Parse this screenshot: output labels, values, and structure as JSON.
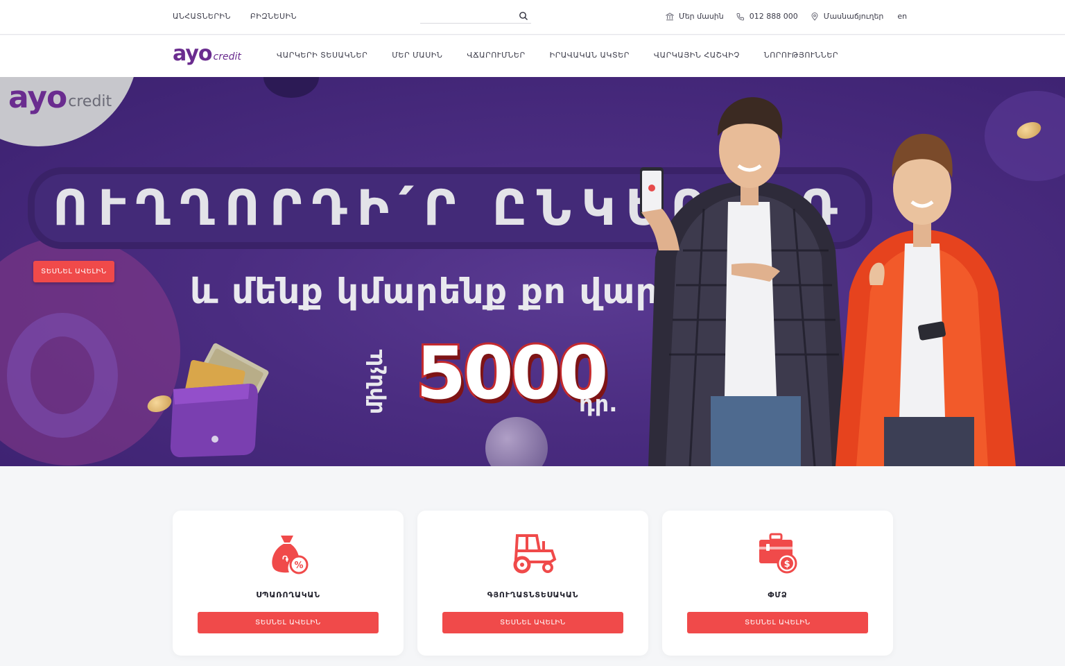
{
  "topbar": {
    "links": [
      "ԱՆՀԱՏՆԵՐԻՆ",
      "ԲԻԶՆԵՍԻՆ"
    ],
    "search_placeholder": "",
    "about": "Մեր մասին",
    "phone": "012 888 000",
    "branches": "Մասնաճյուղեր",
    "lang": "en"
  },
  "nav": {
    "logo_mark": "ayo",
    "logo_credit": "credit",
    "items": [
      "ՎԱՐԿԵՐԻ ՏԵՍԱԿՆԵՐ",
      "ՄԵՐ ՄԱՍԻՆ",
      "ՎՃԱՐՈՒՄՆԵՐ",
      "ԻՐԱՎԱԿԱՆ ԱԿՏԵՐ",
      "ՎԱՐԿԱՅԻՆ ՀԱՇՎԻՉ",
      "ՆՈՐՈՒԹՅՈՒՆՆԵՐ"
    ]
  },
  "hero": {
    "logo_mark": "ayo",
    "logo_credit": "credit",
    "headline": "ՈՒՂՂՈՐԴԻ՛Ր ԸՆԿԵՐՈՋԴ",
    "subline": "և մենք կմարենք քո վարկից",
    "upto": "մինչև",
    "amount": "5000",
    "currency": "դր.",
    "button": "ՏԵՍՆԵԼ ԱՎԵԼԻՆ"
  },
  "cards": [
    {
      "title": "ՍՊԱՌՈՂԱԿԱՆ",
      "button": "ՏԵՍՆԵԼ ԱՎԵԼԻՆ",
      "icon": "money-bag-percent-icon"
    },
    {
      "title": "ԳՅՈՒՂԱՏՆՏԵՍԱԿԱՆ",
      "button": "ՏԵՍՆԵԼ ԱՎԵԼԻՆ",
      "icon": "tractor-icon"
    },
    {
      "title": "ՓՄՁ",
      "button": "ՏԵՍՆԵԼ ԱՎԵԼԻՆ",
      "icon": "briefcase-dollar-icon"
    }
  ],
  "colors": {
    "accent": "#f04a4a",
    "brand_purple": "#6a2c8f",
    "hero_bg": "#4a2c80"
  }
}
